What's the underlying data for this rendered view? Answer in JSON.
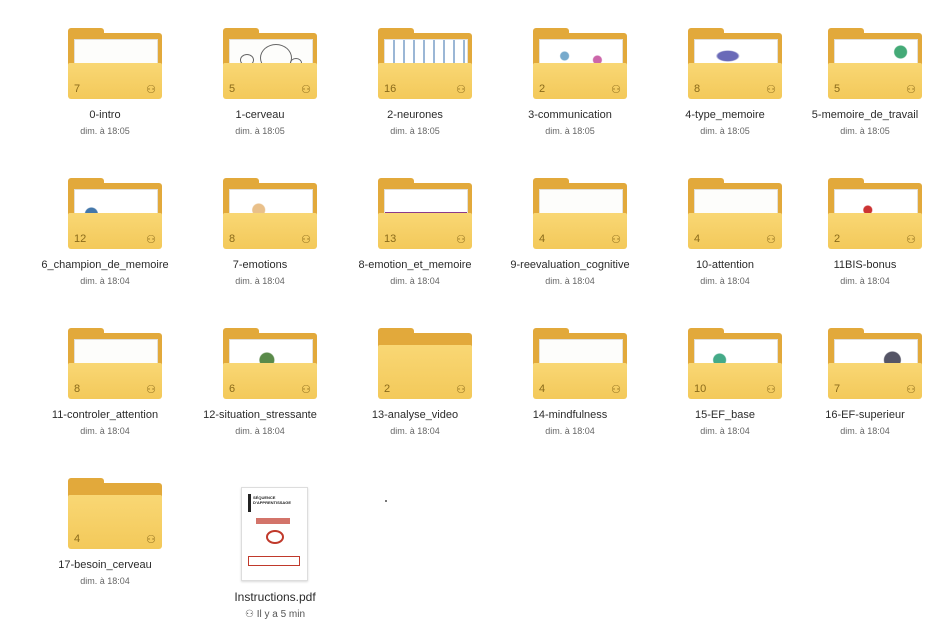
{
  "folders": [
    {
      "name": "0-intro",
      "date": "dim. à 18:05",
      "count": "7",
      "thumb": "intro"
    },
    {
      "name": "1-cerveau",
      "date": "dim. à 18:05",
      "count": "5",
      "thumb": "sketch"
    },
    {
      "name": "2-neurones",
      "date": "dim. à 18:05",
      "count": "16",
      "thumb": "neurons"
    },
    {
      "name": "3-communication",
      "date": "dim. à 18:05",
      "count": "2",
      "thumb": "comm"
    },
    {
      "name": "4-type_memoire",
      "date": "dim. à 18:05",
      "count": "8",
      "thumb": "memory"
    },
    {
      "name": "5-memoire_de_travail",
      "date": "dim. à 18:05",
      "count": "5",
      "thumb": "work"
    },
    {
      "name": "6_champion_de_memoire",
      "date": "dim. à 18:04",
      "count": "12",
      "thumb": "comic"
    },
    {
      "name": "7-emotions",
      "date": "dim. à 18:04",
      "count": "8",
      "thumb": "comic"
    },
    {
      "name": "8-emotion_et_memoire",
      "date": "dim. à 18:04",
      "count": "13",
      "thumb": "purple"
    },
    {
      "name": "9-reevaluation_cognitive",
      "date": "dim. à 18:04",
      "count": "4",
      "thumb": "teal"
    },
    {
      "name": "10-attention",
      "date": "dim. à 18:04",
      "count": "4",
      "thumb": "dark"
    },
    {
      "name": "11BIS-bonus",
      "date": "dim. à 18:04",
      "count": "2",
      "thumb": "comic"
    },
    {
      "name": "11-controler_attention",
      "date": "dim. à 18:04",
      "count": "8",
      "thumb": "window"
    },
    {
      "name": "12-situation_stressante",
      "date": "dim. à 18:04",
      "count": "6",
      "thumb": "comic"
    },
    {
      "name": "13-analyse_video",
      "date": "dim. à 18:04",
      "count": "2",
      "thumb": "empty"
    },
    {
      "name": "14-mindfulness",
      "date": "dim. à 18:04",
      "count": "4",
      "thumb": "grey"
    },
    {
      "name": "15-EF_base",
      "date": "dim. à 18:04",
      "count": "10",
      "thumb": "comic"
    },
    {
      "name": "16-EF-superieur",
      "date": "dim. à 18:04",
      "count": "7",
      "thumb": "comic"
    },
    {
      "name": "17-besoin_cerveau",
      "date": "dim. à 18:04",
      "count": "4",
      "thumb": "empty"
    }
  ],
  "pdf": {
    "name": "Instructions.pdf",
    "date": "Il y a 5 min",
    "shared_icon": "shared-people-icon",
    "thumb_heading_1": "SÉQUENCE",
    "thumb_heading_2": "D'APPRENTISSAGE"
  },
  "icons": {
    "shared": "shared-people-icon",
    "folder": "folder-icon",
    "pdf": "pdf-icon"
  },
  "colors": {
    "folder_front": "#f3c95a",
    "folder_back": "#e2a93b"
  }
}
